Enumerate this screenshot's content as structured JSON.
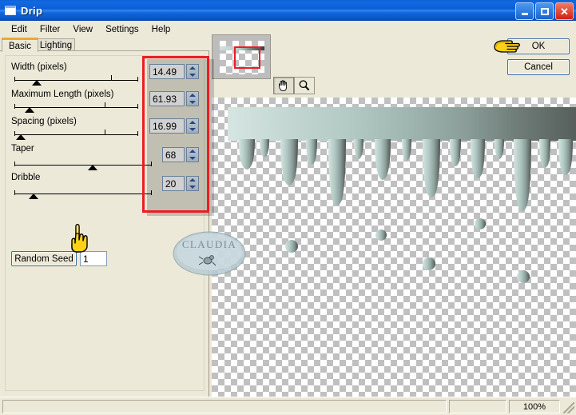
{
  "window": {
    "title": "Drip",
    "icon": "window-icon",
    "buttons": {
      "minimize": "minimize-icon",
      "maximize": "maximize-icon",
      "close": "close-icon"
    }
  },
  "menu": {
    "items": [
      "Edit",
      "Filter",
      "View",
      "Settings",
      "Help"
    ]
  },
  "tabs": [
    {
      "label": "Basic",
      "active": true
    },
    {
      "label": "Lighting",
      "active": false
    }
  ],
  "controls": [
    {
      "label": "Width (pixels)",
      "value": "14.49",
      "thumb_pct": 18,
      "tick_pct": 78
    },
    {
      "label": "Maximum Length (pixels)",
      "value": "61.93",
      "thumb_pct": 12,
      "tick_pct": 73
    },
    {
      "label": "Spacing (pixels)",
      "value": "16.99",
      "thumb_pct": 5,
      "tick_pct": 73
    },
    {
      "label": "Taper",
      "value": "68",
      "thumb_pct": 57,
      "tick_pct": -1
    },
    {
      "label": "Dribble",
      "value": "20",
      "thumb_pct": 14,
      "tick_pct": -1
    }
  ],
  "random_seed": {
    "button_label": "Random Seed",
    "value": "1"
  },
  "dialog_buttons": {
    "ok": "OK",
    "cancel": "Cancel"
  },
  "tools": [
    {
      "name": "pan-tool",
      "glyph": "pan-hand-icon",
      "active": true
    },
    {
      "name": "zoom-tool",
      "glyph": "magnifier-icon",
      "active": false
    }
  ],
  "navigator": {
    "name": "navigator-thumbnail",
    "viewport_rect": "red"
  },
  "statusbar": {
    "zoom": "100%"
  },
  "annotations": {
    "red_highlight": "#ec1c24",
    "hand_pointer_up": "hand-pointing-up-icon",
    "hand_pointer_left": "hand-pointing-right-icon"
  },
  "watermark": {
    "text": "CLAUDIA"
  },
  "theme": {
    "face": "#ece9d8",
    "title_blue": "#0a53c4",
    "accent_orange": "#f0a830",
    "field_border": "#7f9db9"
  }
}
